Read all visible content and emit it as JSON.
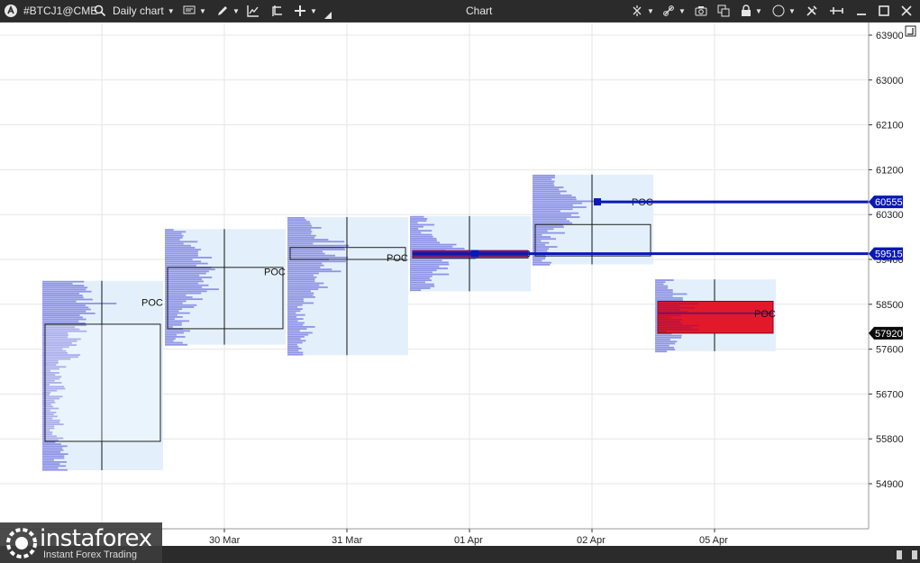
{
  "toolbar": {
    "symbol": "#BTCJ1@CME",
    "chart_type": "Daily chart",
    "window_title": "Chart"
  },
  "colors": {
    "background": "#ffffff",
    "grid": "#e6e6e6",
    "profile_bg": "#e3f0fb",
    "profile_bar": "#8f93e6",
    "value_area_box": "#1e1e1e",
    "poc_line": "#0a18b5",
    "current_area": "#e2192b",
    "current_poc": "#7b1260",
    "price_tag_last": "#0a0a0a"
  },
  "chart_data": {
    "type": "market-profile",
    "x_axis_labels": [
      "30 Mar",
      "31 Mar",
      "01 Apr",
      "02 Apr",
      "05 Apr"
    ],
    "y_ticks": [
      63900,
      63000,
      62100,
      61200,
      60300,
      59400,
      58500,
      57600,
      56700,
      55800,
      54900
    ],
    "ylim": [
      53900,
      64200
    ],
    "poc_label": "POC",
    "profiles": [
      {
        "day": 0,
        "high": 58970,
        "low": 55170,
        "va_high": 58100,
        "va_low": 55750,
        "poc": 58540,
        "poc_extended": false
      },
      {
        "day": 1,
        "high": 60010,
        "low": 57690,
        "va_high": 59240,
        "va_low": 58010,
        "poc": 59160,
        "poc_extended": false
      },
      {
        "day": 2,
        "high": 60250,
        "low": 57480,
        "va_high": 59640,
        "va_low": 59400,
        "poc": 59440,
        "poc_extended": false
      },
      {
        "day": 3,
        "high": 60270,
        "low": 58760,
        "va_high": 59570,
        "va_low": 59430,
        "poc": 59515,
        "poc_extended": true
      },
      {
        "day": 4,
        "high": 61100,
        "low": 59300,
        "va_high": 60100,
        "va_low": 59470,
        "poc": 60555,
        "poc_extended": true
      },
      {
        "day": 5,
        "high": 59000,
        "low": 57560,
        "va_high": 58560,
        "va_low": 57920,
        "poc": 58320,
        "poc_extended": false
      }
    ],
    "price_tags": [
      {
        "value": 60555,
        "label": "60555",
        "style": "poc"
      },
      {
        "value": 59515,
        "label": "59515",
        "style": "poc"
      },
      {
        "value": 57920,
        "label": "57920",
        "style": "last"
      }
    ]
  },
  "watermark": {
    "brand": "instaforex",
    "tagline": "Instant Forex Trading"
  }
}
